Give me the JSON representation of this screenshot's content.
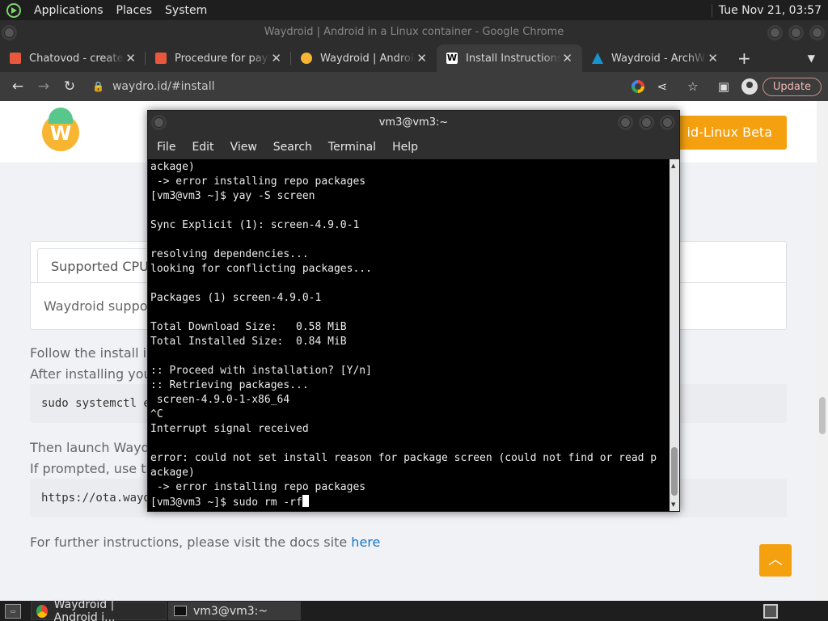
{
  "system_panel": {
    "menu": [
      "Applications",
      "Places",
      "System"
    ],
    "clock": "Tue Nov 21, 03:57"
  },
  "browser": {
    "window_title": "Waydroid | Android in a Linux container - Google Chrome",
    "tabs": [
      {
        "title": "Chatovod - create y",
        "favicon_color": "#e9573f",
        "favicon": "chatovod-favicon"
      },
      {
        "title": "Procedure for paym",
        "favicon_color": "#e9573f",
        "favicon": "procedure-favicon"
      },
      {
        "title": "Waydroid | Android",
        "favicon_color": "#f7b531",
        "favicon": "waydroid-favicon"
      },
      {
        "title": "Install Instructions",
        "favicon_color": "#ffffff",
        "favicon": "wikipedia-favicon",
        "favicon_text": "W"
      },
      {
        "title": "Waydroid - ArchWi",
        "favicon_color": "#1793d1",
        "favicon": "archwiki-favicon"
      }
    ],
    "active_tab_index": 3,
    "new_tab_label": "+",
    "url": "waydro.id/#install",
    "update_label": "Update"
  },
  "webpage": {
    "beta_button": "id-Linux Beta",
    "supported_tab": "Supported CPU",
    "supported_text": "Waydroid suppor",
    "para1_line1": "Follow the install ins",
    "para1_line2": "After installing you",
    "code1": "sudo systemctl e",
    "para2_line1": "Then launch Waydr",
    "para2_line2": "If prompted, use th",
    "code2": "https://ota.wayd",
    "further_text": "For further instructions, please visit the docs site ",
    "further_link": "here"
  },
  "terminal": {
    "title": "vm3@vm3:~",
    "menu": [
      "File",
      "Edit",
      "View",
      "Search",
      "Terminal",
      "Help"
    ],
    "lines": [
      "ackage)",
      " -> error installing repo packages",
      "[vm3@vm3 ~]$ yay -S screen",
      "",
      "Sync Explicit (1): screen-4.9.0-1",
      "",
      "resolving dependencies...",
      "looking for conflicting packages...",
      "",
      "Packages (1) screen-4.9.0-1",
      "",
      "Total Download Size:   0.58 MiB",
      "Total Installed Size:  0.84 MiB",
      "",
      ":: Proceed with installation? [Y/n]",
      ":: Retrieving packages...",
      " screen-4.9.0-1-x86_64",
      "^C",
      "Interrupt signal received",
      "",
      "error: could not set install reason for package screen (could not find or read p",
      "ackage)",
      " -> error installing repo packages"
    ],
    "prompt_line": "[vm3@vm3 ~]$ sudo rm -rf"
  },
  "taskbar": {
    "tasks": [
      {
        "label": "Waydroid | Android i...",
        "icon": "chrome-icon"
      },
      {
        "label": "vm3@vm3:~",
        "icon": "terminal-icon"
      }
    ]
  }
}
